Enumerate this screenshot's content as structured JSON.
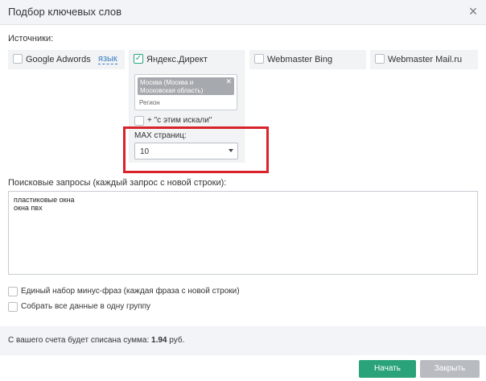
{
  "dialog": {
    "title": "Подбор ключевых слов",
    "close_glyph": "×"
  },
  "sources": {
    "label": "Источники:",
    "google": {
      "name": "Google Adwords",
      "checked": false,
      "lang_link": "язык"
    },
    "yandex": {
      "name": "Яндекс.Директ",
      "checked": true
    },
    "bing": {
      "name": "Webmaster Bing",
      "checked": false
    },
    "mailru": {
      "name": "Webmaster Mail.ru",
      "checked": false
    }
  },
  "yandex_options": {
    "region_tag": "Москва (Москва и Московская область)",
    "region_placeholder": "Регион",
    "also_searched": "+ \"с этим искали\"",
    "max_pages_label": "MAX страниц:",
    "max_pages_value": "10"
  },
  "queries": {
    "label": "Поисковые запросы (каждый запрос с новой строки):",
    "value": "пластиковые окна\nокна пвх"
  },
  "options": {
    "minus_phrases": "Единый набор минус-фраз (каждая фраза с новой строки)",
    "one_group": "Собрать все данные в одну группу"
  },
  "footer": {
    "charge_text": "С вашего счета будет списана сумма:",
    "amount": "1.94",
    "currency": "руб."
  },
  "buttons": {
    "start": "Начать",
    "close": "Закрыть"
  },
  "colors": {
    "accent": "#2aa37a",
    "highlight": "#d9222a",
    "link": "#3b7cc4"
  }
}
